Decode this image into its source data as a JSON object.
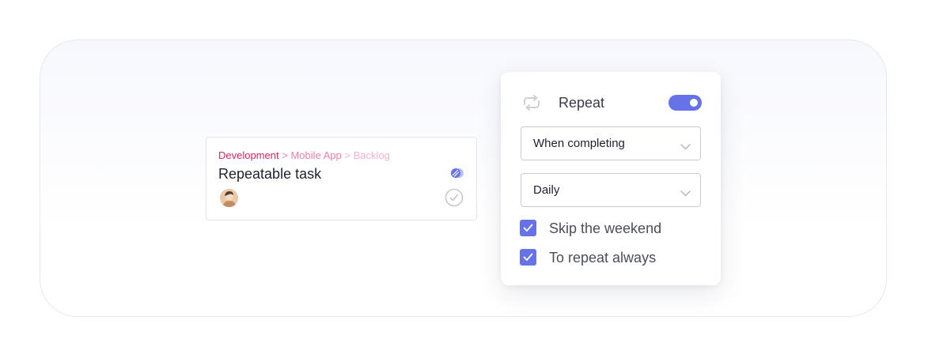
{
  "task": {
    "breadcrumb": [
      "Development",
      "Mobile App",
      "Backlog"
    ],
    "breadcrumb_separator": ">",
    "title": "Repeatable task"
  },
  "repeat_popup": {
    "label": "Repeat",
    "enabled": true,
    "trigger_select": {
      "value": "When completing"
    },
    "frequency_select": {
      "value": "Daily"
    },
    "options": [
      {
        "label": "Skip the weekend",
        "checked": true
      },
      {
        "label": "To repeat always",
        "checked": true
      }
    ]
  },
  "colors": {
    "accent": "#6672e8",
    "breadcrumb_primary": "#e0245e",
    "breadcrumb_secondary": "#ec7fa3",
    "breadcrumb_tertiary": "#f2b3c8"
  },
  "icons": {
    "task_badge": "repeat-badge-icon",
    "complete": "check-circle-icon",
    "repeat": "repeat-icon",
    "dropdown": "chevron-down-icon",
    "checkbox": "checkmark-icon"
  }
}
